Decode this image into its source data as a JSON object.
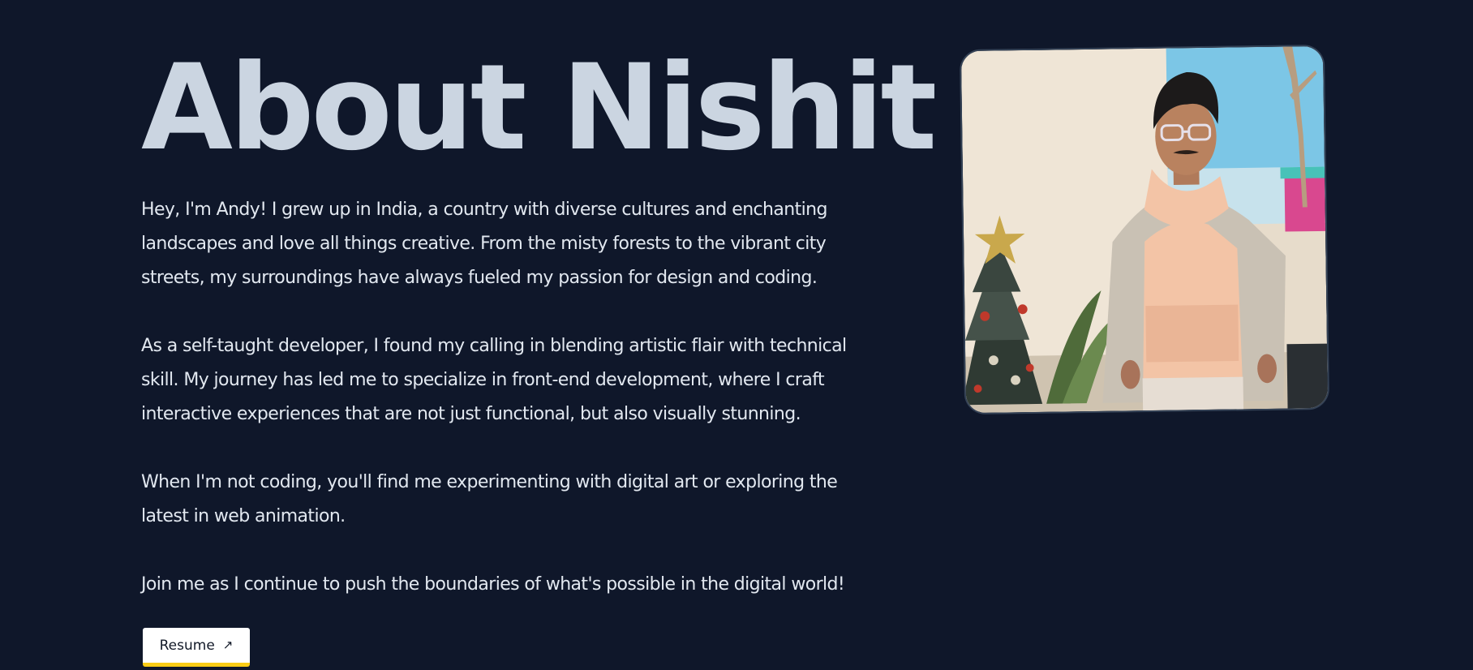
{
  "about": {
    "title": "About Nishit",
    "paragraphs": [
      "Hey, I'm Andy! I grew up in India, a country with diverse cultures and enchanting landscapes and love all things creative. From the misty forests to the vibrant city streets, my surroundings have always fueled my passion for design and coding.",
      "As a self-taught developer, I found my calling in blending artistic flair with technical skill. My journey has led me to specialize in front-end development, where I craft interactive experiences that are not just functional, but also visually stunning.",
      "When I'm not coding, you'll find me experimenting with digital art or exploring the latest in web animation.",
      "Join me as I continue to push the boundaries of what's possible in the digital world!"
    ],
    "resume_label": "Resume",
    "resume_icon": "arrow-up-right-icon"
  },
  "colors": {
    "background": "#0f172a",
    "title": "#cbd5e1",
    "text": "#e2e8f0",
    "button_bg": "#ffffff",
    "button_accent": "#facc15"
  }
}
